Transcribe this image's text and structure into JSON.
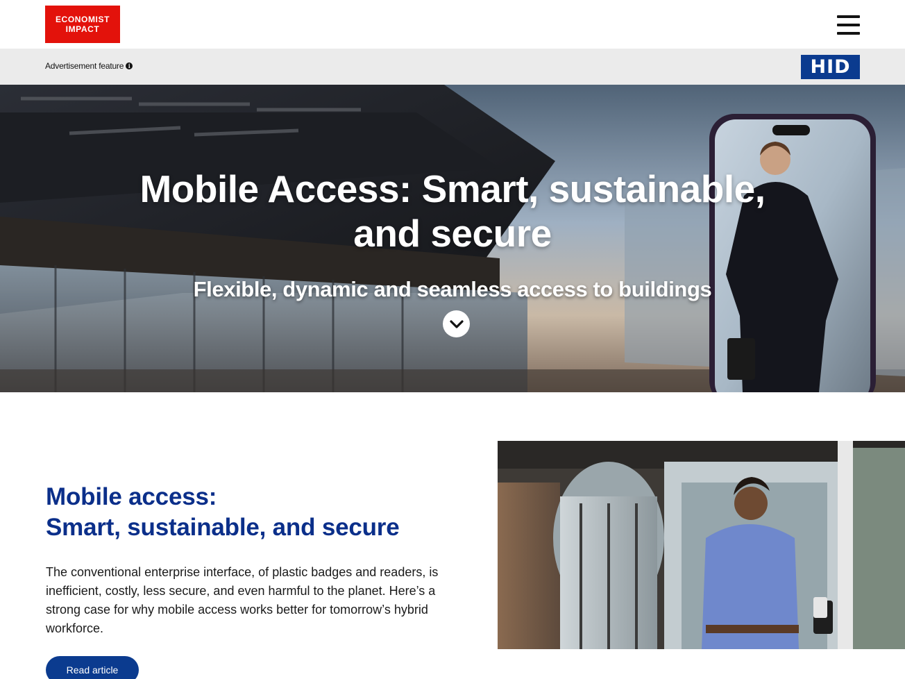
{
  "header": {
    "logo_line1": "ECONOMIST",
    "logo_line2": "IMPACT",
    "menu_icon": "hamburger-menu-icon"
  },
  "ad_strip": {
    "label": "Advertisement feature",
    "info_icon": "i",
    "sponsor_logo": "HID"
  },
  "hero": {
    "title_line1": "Mobile Access: Smart, sustainable,",
    "title_line2": "and secure",
    "subtitle": "Flexible, dynamic and seamless access to buildings",
    "scroll_icon": "chevron-down-icon"
  },
  "article": {
    "title_line1": "Mobile access:",
    "title_line2": "Smart, sustainable, and secure",
    "body": "The conventional enterprise interface, of plastic badges and readers, is inefficient, costly, less secure, and even harmful to the planet. Here’s a strong case for why mobile access works better for tomorrow’s hybrid workforce.",
    "cta_label": "Read article"
  },
  "colors": {
    "brand_red": "#e3120b",
    "hid_blue": "#0b3b8f",
    "heading_blue": "#0b2f8a",
    "ad_strip_bg": "#ebebeb"
  }
}
